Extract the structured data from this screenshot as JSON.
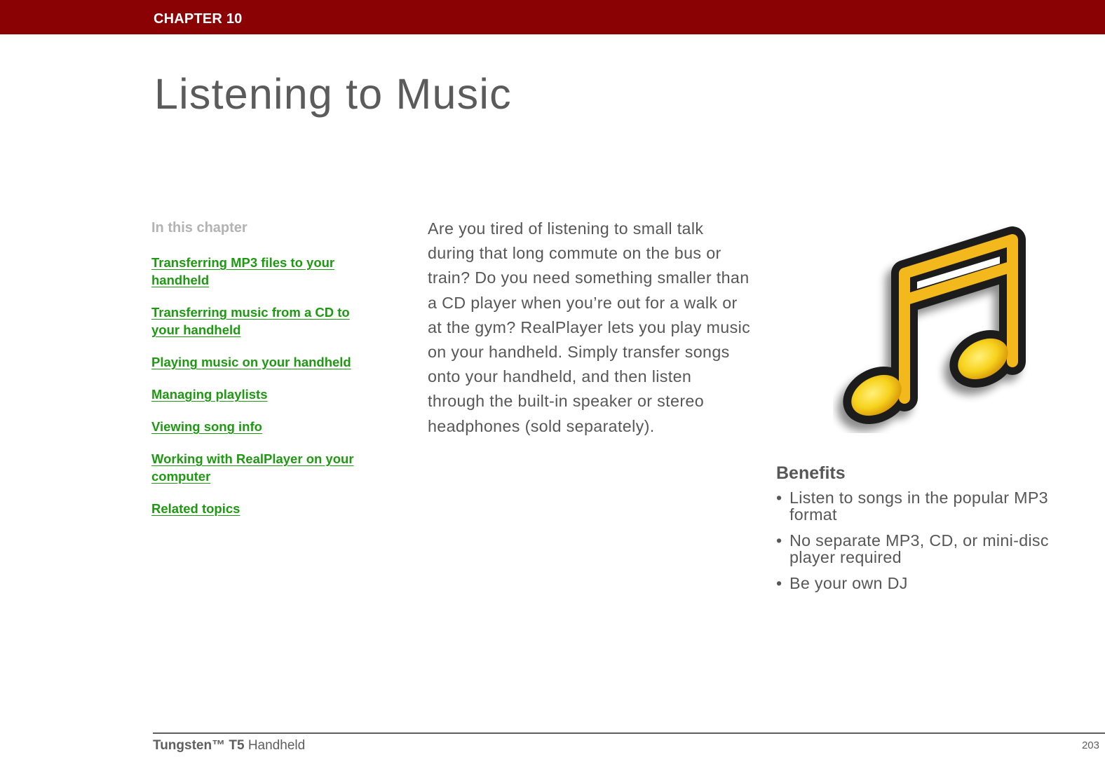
{
  "header": {
    "chapter_label": "CHAPTER 10",
    "bar_color": "#8a0204"
  },
  "page_title": "Listening to Music",
  "toc": {
    "heading": "In this chapter",
    "link_color": "#1e9a12",
    "links": [
      {
        "label": "Transferring MP3 files to your handheld"
      },
      {
        "label": "Transferring music from a CD to your handheld"
      },
      {
        "label": "Playing music on your handheld"
      },
      {
        "label": "Managing playlists"
      },
      {
        "label": "Viewing song info"
      },
      {
        "label": "Working with RealPlayer on your computer"
      },
      {
        "label": "Related topics"
      }
    ]
  },
  "intro": {
    "text": "Are you tired of listening to small talk during that long commute on the bus or train? Do you need something smaller than a CD player when you’re out for a walk or at the gym? RealPlayer lets you play music on your handheld. Simply transfer songs onto your handheld, and then listen through the built-in speaker or stereo headphones (sold separately)."
  },
  "illustration": {
    "icon": "music-note-icon",
    "fill_color": "#f5c01a",
    "outline_color": "#1a1a1a"
  },
  "benefits": {
    "heading": "Benefits",
    "bullet": "•",
    "items": [
      {
        "text": "Listen to songs in the popular MP3 format"
      },
      {
        "text": "No separate MP3, CD, or mini-disc player required"
      },
      {
        "text": "Be your own DJ"
      }
    ]
  },
  "footer": {
    "product_name": "Tungsten™ T5",
    "product_suffix": " Handheld",
    "page_number": "203"
  }
}
